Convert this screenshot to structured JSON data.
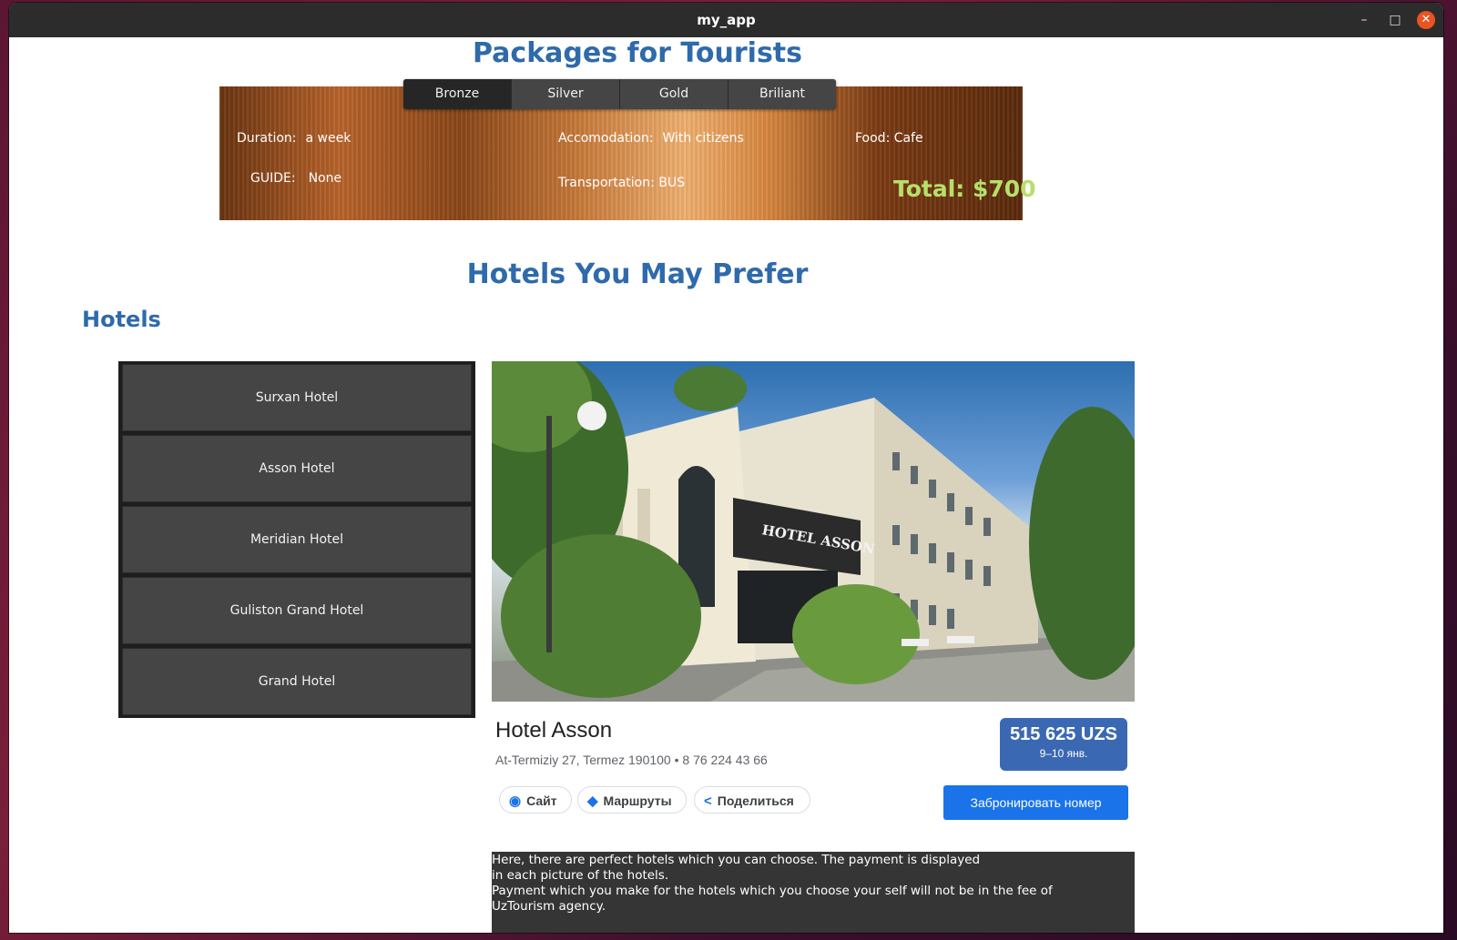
{
  "window": {
    "title": "my_app",
    "controls": {
      "minimize": "–",
      "maximize": "□",
      "close": "✕"
    }
  },
  "packages": {
    "heading": "Packages for Tourists",
    "tabs": [
      "Bronze",
      "Silver",
      "Gold",
      "Briliant"
    ],
    "active_tab": "Bronze",
    "duration_label": "Duration:",
    "duration_value": "a week",
    "guide_label": "GUIDE:",
    "guide_value": "None",
    "accommodation_label": "Accomodation:",
    "accommodation_value": "With citizens",
    "transportation": "Transportation: BUS",
    "food": "Food: Cafe",
    "total": "Total: $700"
  },
  "hotels_section": {
    "heading": "Hotels You May Prefer",
    "subheading": "Hotels",
    "hotel_list": [
      "Surxan Hotel",
      "Asson Hotel",
      "Meridian Hotel",
      "Guliston Grand Hotel",
      "Grand Hotel"
    ]
  },
  "hotel_card": {
    "sign": "HOTEL ASSON",
    "name": "Hotel Asson",
    "address": "At-Termiziy 27, Termez 190100 • 8 76 224 43 66",
    "price": "515 625 UZS",
    "dates": "9–10 янв.",
    "chip_site": "Сайт",
    "chip_routes": "Маршруты",
    "chip_share": "Поделиться",
    "book_button": "Забронировать номер"
  },
  "info_text": [
    "Here, there are perfect hotels which you can choose. The payment is displayed",
    "in each picture of the hotels.",
    "Payment which you make for the hotels which you choose your self will not be in the fee of",
    "UzTourism agency."
  ]
}
